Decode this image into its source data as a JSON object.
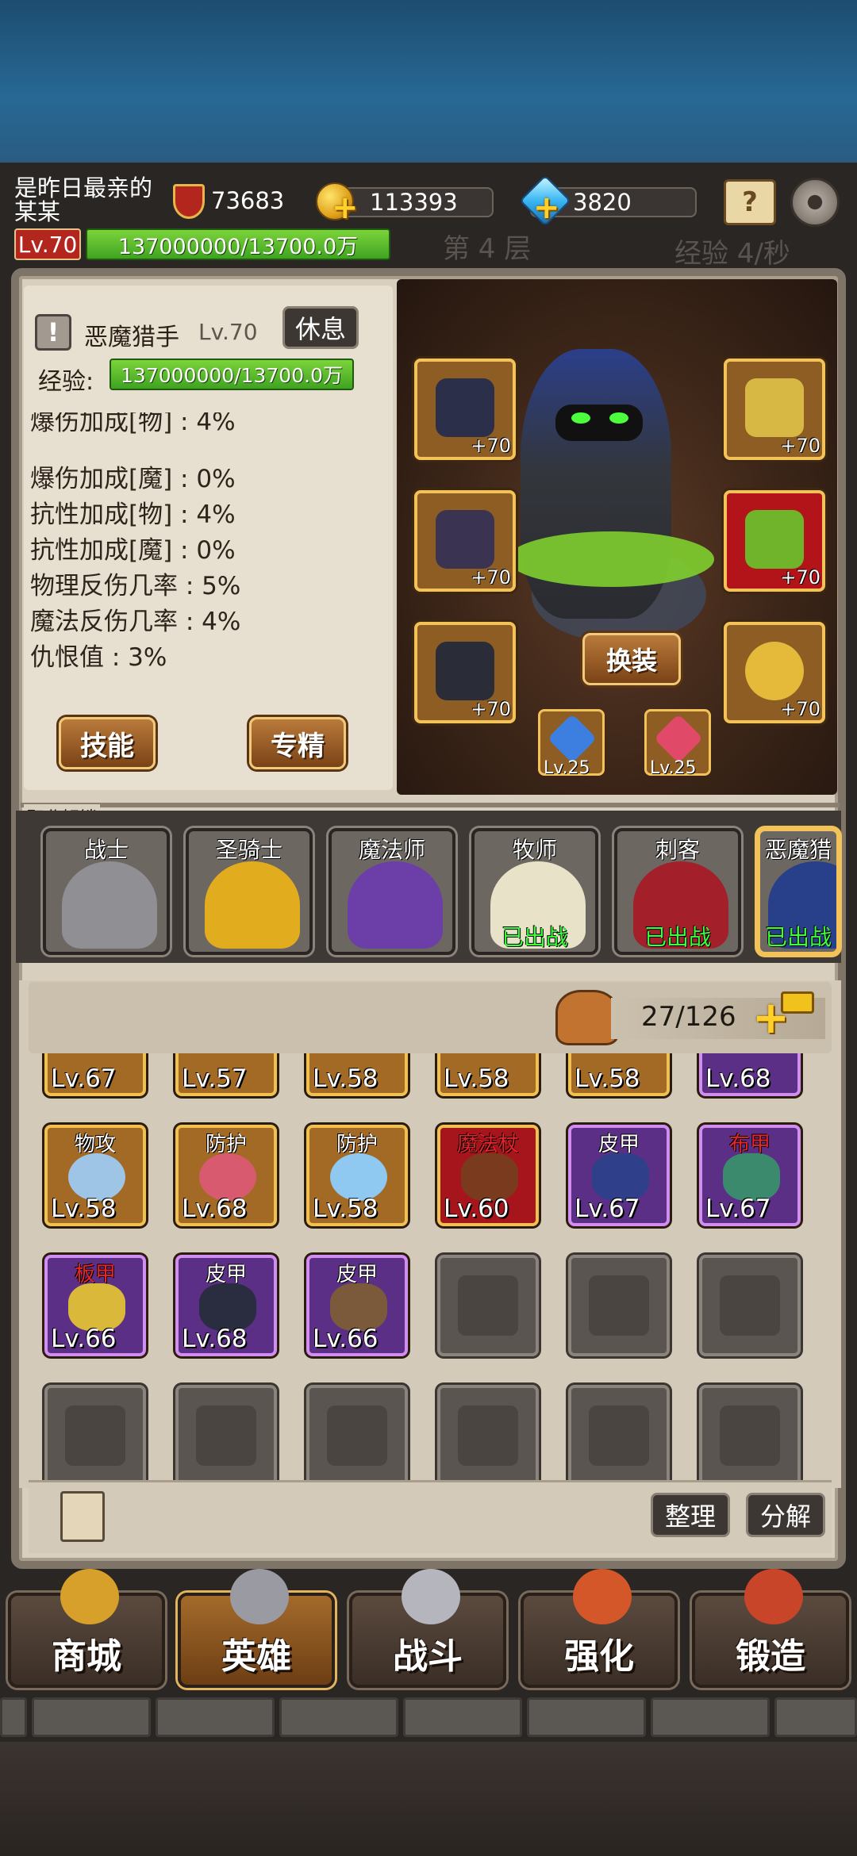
{
  "player": {
    "name": "是昨日最亲的某某",
    "level": "Lv.70",
    "power": "73683",
    "gold": "113393",
    "gems": "3820",
    "exp": "137000000/13700.0万"
  },
  "floor": "第 4 层",
  "exp_rate": "经验 4/秒",
  "hero": {
    "name": "恶魔猎手",
    "level": "Lv.70",
    "rest_label": "休息",
    "exp_label": "经验:",
    "exp": "137000000/13700.0万",
    "stats": [
      "爆伤加成[魔] : 0%",
      "抗性加成[物] : 4%",
      "抗性加成[魔] : 0%",
      "物理反伤几率 : 5%",
      "魔法反伤几率 : 4%",
      "仇恨值 : 3%"
    ],
    "skill_button": "技能",
    "specialty_button": "专精",
    "change_button": "换装",
    "equip_bonus": [
      "+70",
      "+70",
      "+70",
      "+70",
      "+70",
      "+70"
    ],
    "small_slots": [
      "Lv.25",
      "Lv.25"
    ]
  },
  "class_unlock": {
    "title": "职业解锁",
    "classes": [
      {
        "name": "战士",
        "status": ""
      },
      {
        "name": "圣骑士",
        "status": ""
      },
      {
        "name": "魔法师",
        "status": ""
      },
      {
        "name": "牧师",
        "status": "已出战"
      },
      {
        "name": "刺客",
        "status": "已出战"
      },
      {
        "name": "恶魔猎",
        "status": "已出战"
      }
    ]
  },
  "bag": {
    "capacity": "27/126",
    "row0": [
      "Lv.67",
      "Lv.57",
      "Lv.58",
      "Lv.58",
      "Lv.58",
      "Lv.68"
    ],
    "row1": [
      {
        "tag": "物攻",
        "lv": "Lv.58"
      },
      {
        "tag": "防护",
        "lv": "Lv.68"
      },
      {
        "tag": "防护",
        "lv": "Lv.58"
      },
      {
        "tag": "魔法杖",
        "lv": "Lv.60"
      },
      {
        "tag": "皮甲",
        "lv": "Lv.67"
      },
      {
        "tag": "布甲",
        "lv": "Lv.67"
      }
    ],
    "row2": [
      {
        "tag": "板甲",
        "lv": "Lv.66"
      },
      {
        "tag": "皮甲",
        "lv": "Lv.68"
      },
      {
        "tag": "皮甲",
        "lv": "Lv.66"
      }
    ],
    "sort_button": "整理",
    "decompose_button": "分解"
  },
  "nav": [
    "商城",
    "英雄",
    "战斗",
    "强化",
    "锻造"
  ],
  "colors": {
    "accent": "#f3c35a",
    "exp_bar": "#4fb829",
    "level_badge": "#b3261e",
    "equipped_text": "#3cff3c"
  }
}
